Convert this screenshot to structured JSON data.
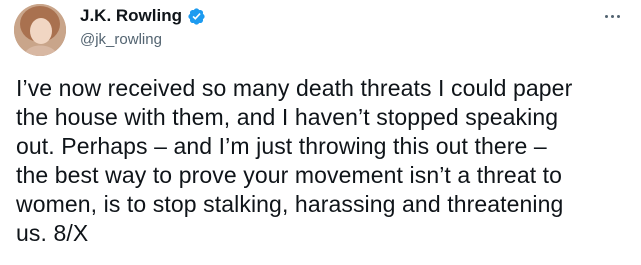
{
  "tweet": {
    "author": {
      "display_name": "J.K. Rowling",
      "handle": "@jk_rowling",
      "verified": true
    },
    "text": "I’ve now received so many death threats I could paper\nthe house with them, and I haven’t stopped speaking\nout. Perhaps – and I’m just throwing this out there –\nthe best way to prove your movement isn’t a threat to\nwomen, is to stop stalking, harassing and threatening\nus. 8/X"
  },
  "icons": {
    "verified": "verified-badge-icon",
    "more": "more-options-icon",
    "avatar": "avatar"
  },
  "colors": {
    "text": "#0f1419",
    "secondary": "#536471",
    "verified_blue": "#1d9bf0",
    "background": "#ffffff"
  }
}
